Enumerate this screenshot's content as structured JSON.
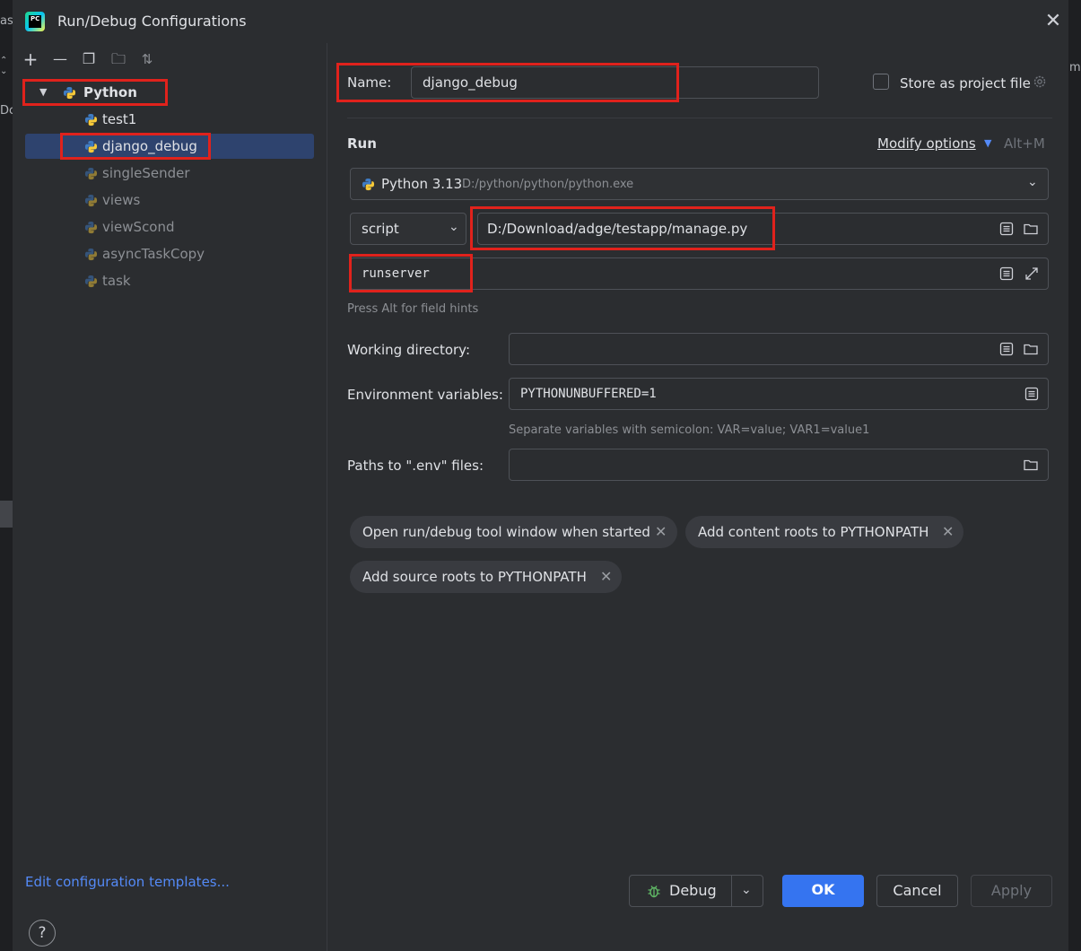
{
  "background": {
    "left_fragments": [
      "as",
      "Dc"
    ],
    "right_fragments": [
      "m"
    ]
  },
  "window": {
    "title": "Run/Debug Configurations",
    "app_badge": "PC"
  },
  "left": {
    "toolbar": [
      {
        "name": "add-icon",
        "glyph": "+"
      },
      {
        "name": "remove-icon",
        "glyph": "—"
      },
      {
        "name": "copy-icon",
        "glyph": "❐"
      },
      {
        "name": "new-folder-icon",
        "glyph": "🗀"
      },
      {
        "name": "sort-icon",
        "glyph": "⇅"
      }
    ],
    "tree": {
      "group": "Python",
      "items": [
        "test1",
        "django_debug",
        "singleSender",
        "views",
        "viewScond",
        "asyncTaskCopy",
        "task"
      ]
    },
    "edit_templates": "Edit configuration templates...",
    "help": "?"
  },
  "form": {
    "name_label": "Name:",
    "name_value": "django_debug",
    "store_label": "Store as project file",
    "store_checked": false,
    "section": "Run",
    "modify_options": "Modify options",
    "modify_shortcut": "Alt+M",
    "interpreter_name": "Python 3.13",
    "interpreter_path": "D:/python/python/python.exe",
    "run_type": "script",
    "script_path": "D:/Download/adge/testapp/manage.py",
    "parameters": "runserver",
    "field_hint": "Press Alt for field hints",
    "working_dir_label": "Working directory:",
    "working_dir_value": "",
    "env_label": "Environment variables:",
    "env_value": "PYTHONUNBUFFERED=1",
    "env_hint": "Separate variables with semicolon: VAR=value; VAR1=value1",
    "dotenv_label": "Paths to \".env\" files:",
    "dotenv_value": "",
    "chips": [
      "Open run/debug tool window when started",
      "Add content roots to PYTHONPATH",
      "Add source roots to PYTHONPATH"
    ]
  },
  "footer": {
    "debug": "Debug",
    "ok": "OK",
    "cancel": "Cancel",
    "apply": "Apply"
  },
  "colors": {
    "accent": "#548af7",
    "primary_button": "#3574f0",
    "selection": "#2e436e",
    "highlight_box": "#e0221c"
  }
}
